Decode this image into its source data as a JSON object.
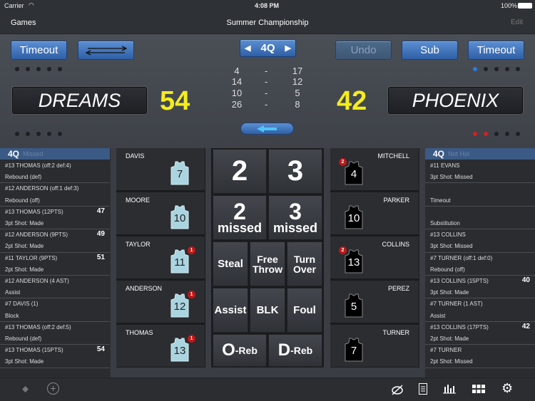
{
  "status": {
    "carrier": "Carrier",
    "time": "4:08 PM",
    "battery": "100%"
  },
  "nav": {
    "back": "Games",
    "title": "Summer Championship",
    "edit": "Edit"
  },
  "controls": {
    "timeout_left": "Timeout",
    "swap_icon": "swap-arrows-icon",
    "quarter": "4Q",
    "undo": "Undo",
    "sub": "Sub",
    "timeout_right": "Timeout"
  },
  "scoreboard": {
    "home_team": "DREAMS",
    "home_score": "54",
    "away_team": "PHOENIX",
    "away_score": "42",
    "quarters": [
      {
        "home": "4",
        "sep": "-",
        "away": "17"
      },
      {
        "home": "14",
        "sep": "-",
        "away": "12"
      },
      {
        "home": "10",
        "sep": "-",
        "away": "5"
      },
      {
        "home": "26",
        "sep": "-",
        "away": "8"
      }
    ],
    "possession_icon": "arrow-left-icon"
  },
  "left_log": {
    "header": "4Q",
    "header_ghost": "Missed",
    "rows": [
      {
        "text": "#13 THOMAS (off:2 def:4)",
        "num": ""
      },
      {
        "text": "Rebound (def)",
        "num": ""
      },
      {
        "text": "#12 ANDERSON (off:1 def:3)",
        "num": ""
      },
      {
        "text": "Rebound (off)",
        "num": ""
      },
      {
        "text": "#13 THOMAS (12PTS)",
        "num": "47"
      },
      {
        "text": "3pt Shot: Made",
        "num": ""
      },
      {
        "text": "#12 ANDERSON (9PTS)",
        "num": "49"
      },
      {
        "text": "2pt Shot: Made",
        "num": ""
      },
      {
        "text": "#11 TAYLOR (9PTS)",
        "num": "51"
      },
      {
        "text": "2pt Shot: Made",
        "num": ""
      },
      {
        "text": "#12 ANDERSON (4 AST)",
        "num": ""
      },
      {
        "text": "Assist",
        "num": ""
      },
      {
        "text": "#7 DAVIS (1)",
        "num": ""
      },
      {
        "text": "Block",
        "num": ""
      },
      {
        "text": "#13 THOMAS (off:2 def:5)",
        "num": ""
      },
      {
        "text": "Rebound (def)",
        "num": ""
      },
      {
        "text": "#13 THOMAS (15PTS)",
        "num": "54"
      },
      {
        "text": "3pt Shot: Made",
        "num": ""
      }
    ]
  },
  "right_log": {
    "header": "4Q",
    "header_ghost": "Not Hol",
    "rows": [
      {
        "text": "#11 EVANS",
        "num": ""
      },
      {
        "text": "3pt Shot: Missed",
        "num": ""
      },
      {
        "text": "",
        "num": ""
      },
      {
        "text": "Timeout",
        "num": ""
      },
      {
        "text": "",
        "num": ""
      },
      {
        "text": "Substitution",
        "num": ""
      },
      {
        "text": "#13 COLLINS",
        "num": ""
      },
      {
        "text": "3pt Shot: Missed",
        "num": ""
      },
      {
        "text": "#7 TURNER (off:1 def:0)",
        "num": ""
      },
      {
        "text": "Rebound (off)",
        "num": ""
      },
      {
        "text": "#13 COLLINS (15PTS)",
        "num": "40"
      },
      {
        "text": "3pt Shot: Made",
        "num": ""
      },
      {
        "text": "#7 TURNER (1 AST)",
        "num": ""
      },
      {
        "text": "Assist",
        "num": ""
      },
      {
        "text": "#13 COLLINS (17PTS)",
        "num": "42"
      },
      {
        "text": "2pt Shot: Made",
        "num": ""
      },
      {
        "text": "#7 TURNER",
        "num": ""
      },
      {
        "text": "2pt Shot: Missed",
        "num": ""
      }
    ]
  },
  "home_players": [
    {
      "name": "DAVIS",
      "number": "7",
      "fouls": ""
    },
    {
      "name": "MOORE",
      "number": "10",
      "fouls": ""
    },
    {
      "name": "TAYLOR",
      "number": "11",
      "fouls": "1"
    },
    {
      "name": "ANDERSON",
      "number": "12",
      "fouls": "1"
    },
    {
      "name": "THOMAS",
      "number": "13",
      "fouls": "1"
    }
  ],
  "away_players": [
    {
      "name": "MITCHELL",
      "number": "4",
      "fouls": "2"
    },
    {
      "name": "PARKER",
      "number": "10",
      "fouls": ""
    },
    {
      "name": "COLLINS",
      "number": "13",
      "fouls": "2"
    },
    {
      "name": "PEREZ",
      "number": "5",
      "fouls": ""
    },
    {
      "name": "TURNER",
      "number": "7",
      "fouls": ""
    }
  ],
  "stat_buttons": {
    "two": "2",
    "three": "3",
    "two_missed_num": "2",
    "two_missed_label": "missed",
    "three_missed_num": "3",
    "three_missed_label": "missed",
    "steal": "Steal",
    "free_throw_1": "Free",
    "free_throw_2": "Throw",
    "turnover_1": "Turn",
    "turnover_2": "Over",
    "assist": "Assist",
    "block": "BLK",
    "foul": "Foul",
    "oreb_big": "O",
    "oreb_small": "-Reb",
    "dreb_big": "D",
    "dreb_small": "-Reb"
  },
  "toolbar_icons": [
    "tag-icon",
    "add-circle-icon",
    "court-icon",
    "list-icon",
    "bar-chart-icon",
    "grid-icon",
    "settings-icon"
  ],
  "colors": {
    "score_yellow": "#f5ec1c",
    "accent_blue": "#3b6fb8",
    "foul_red": "#c01616",
    "home_jersey": "#a9d4e0",
    "away_jersey": "#000000"
  }
}
